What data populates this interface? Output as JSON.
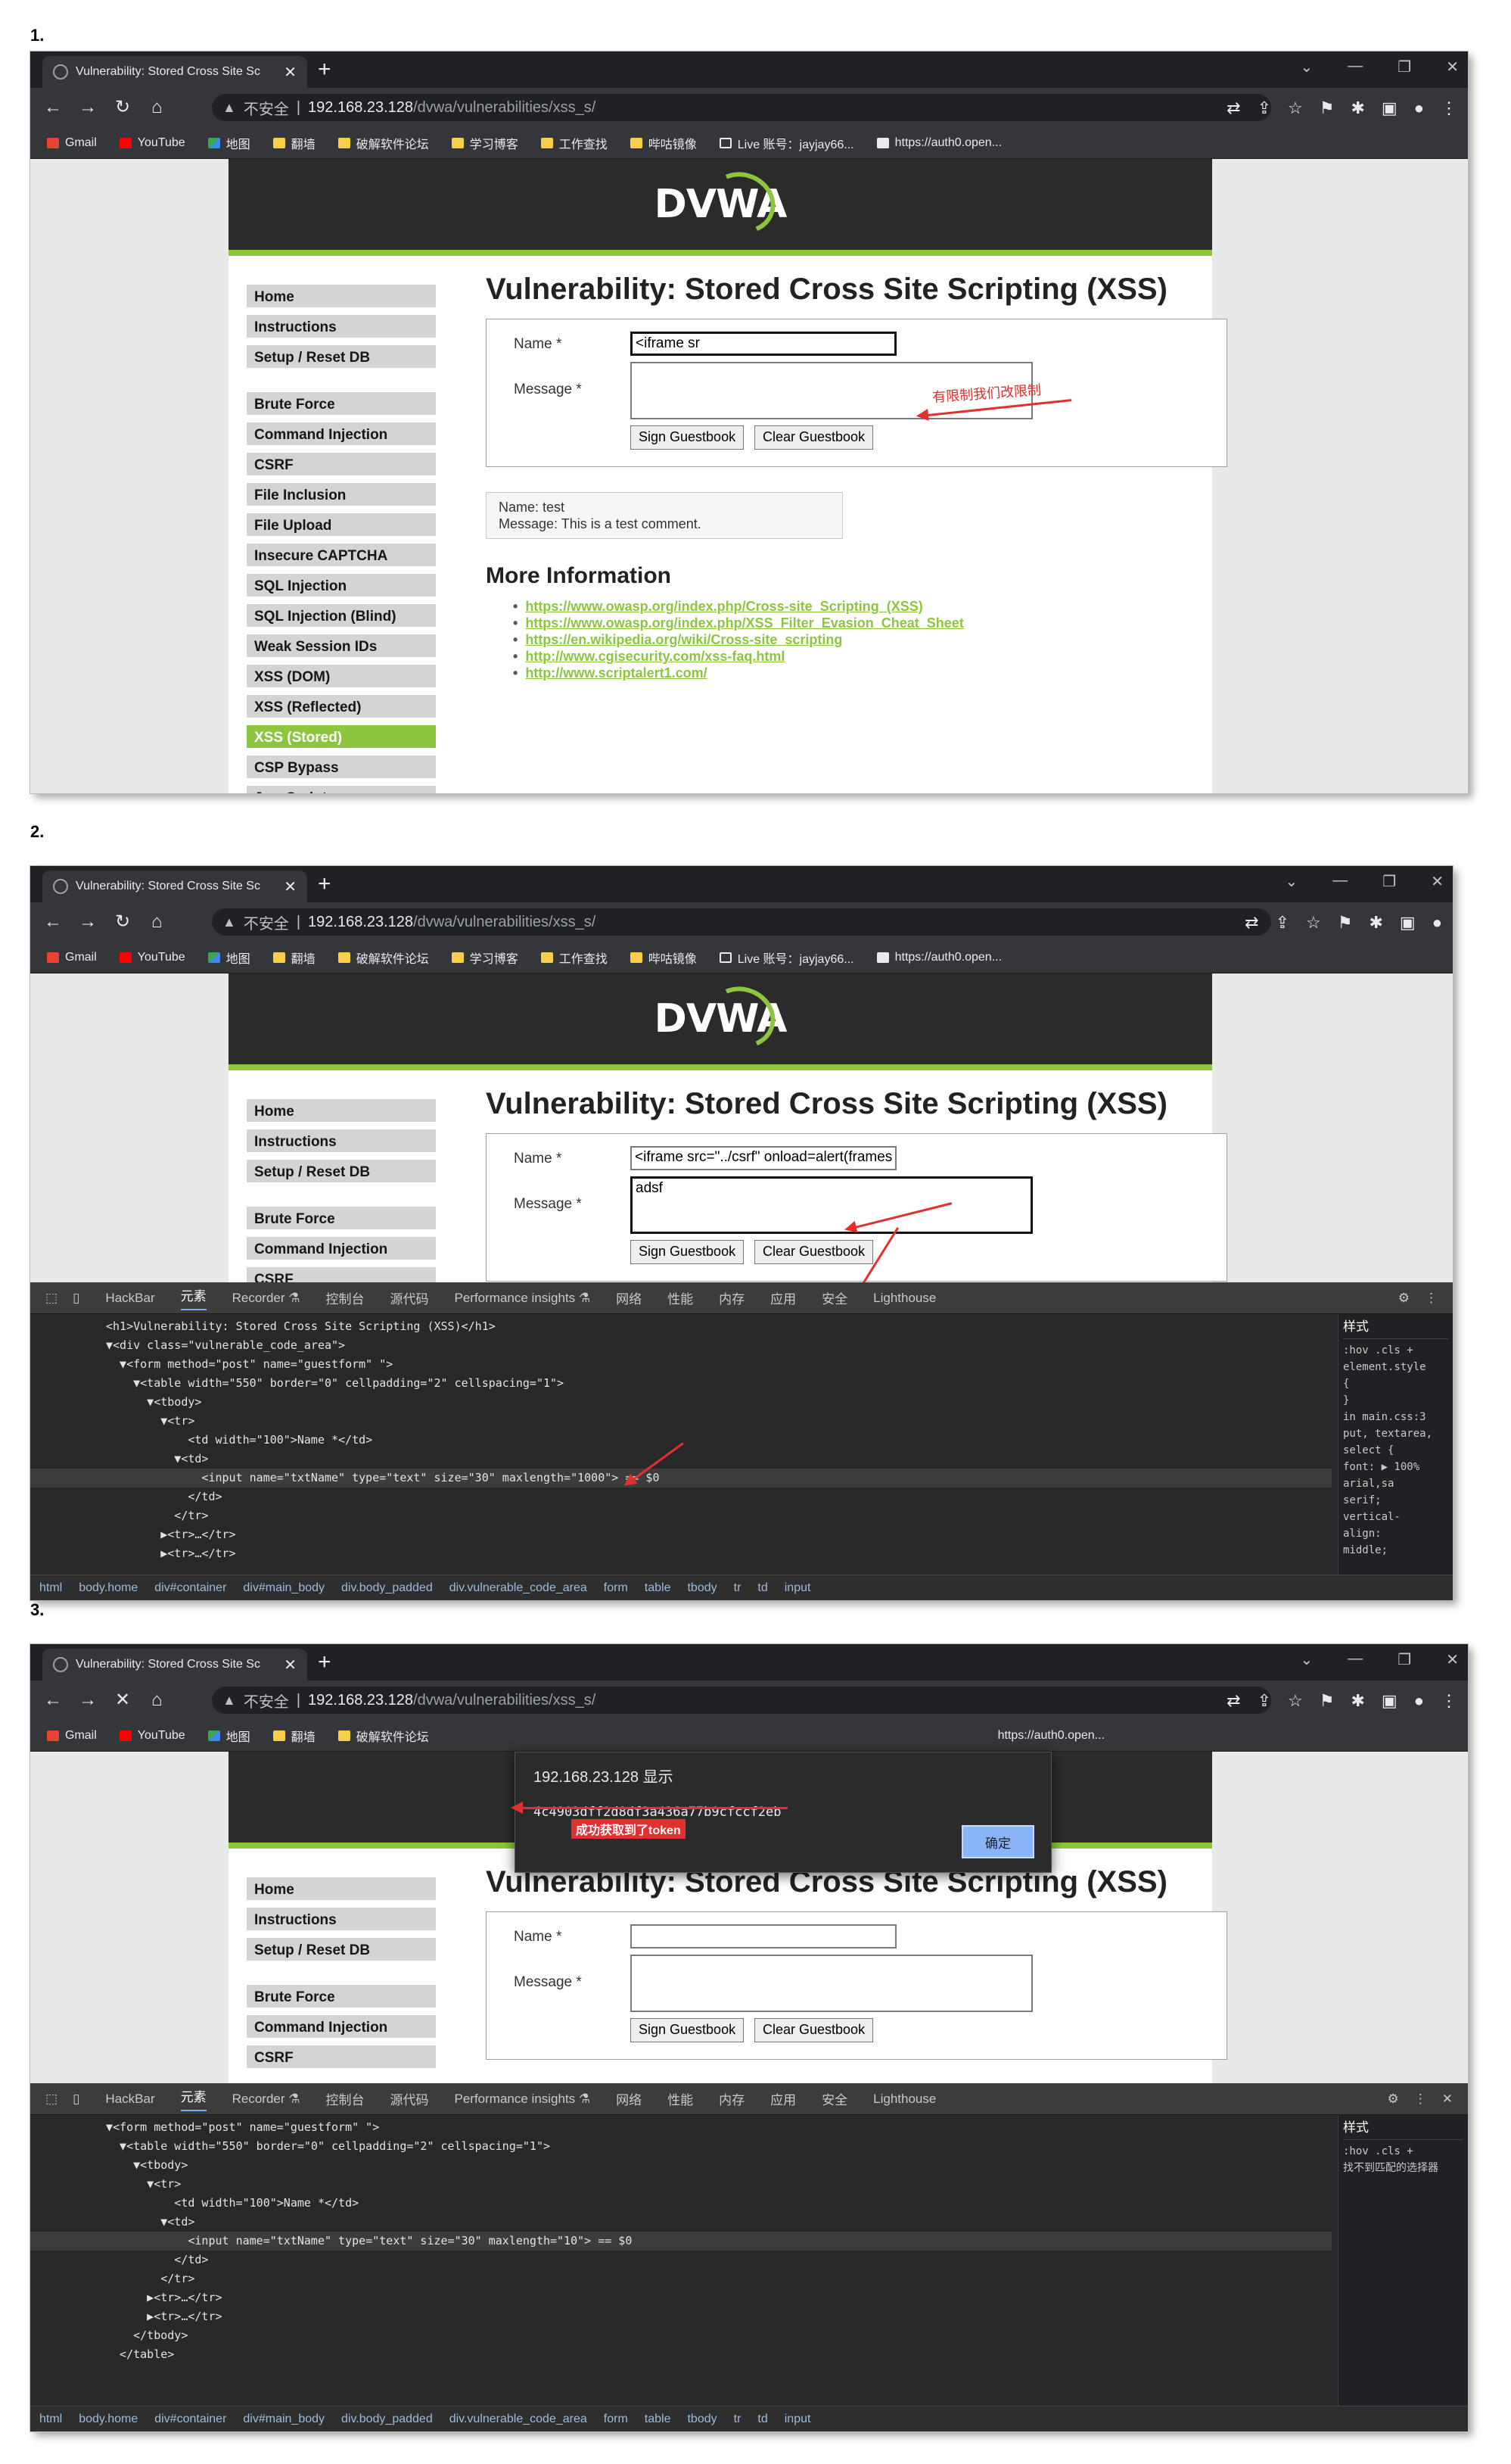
{
  "steps": [
    "1.",
    "2.",
    "3."
  ],
  "browser": {
    "tab_title": "Vulnerability: Stored Cross Site Sc",
    "insecure_label": "不安全",
    "url_host": "192.168.23.128",
    "url_path": "/dvwa/vulnerabilities/xss_s/",
    "bookmarks": [
      "Gmail",
      "YouTube",
      "地图",
      "翻墙",
      "破解软件论坛",
      "学习博客",
      "工作查找",
      "哔咕镜像",
      "Live 账号：jayjay66...",
      "https://auth0.open..."
    ]
  },
  "dvwa": {
    "logo": "DVWA",
    "title": "Vulnerability: Stored Cross Site Scripting (XSS)",
    "name_label": "Name *",
    "message_label": "Message *",
    "sign_button": "Sign Guestbook",
    "clear_button": "Clear Guestbook",
    "guestbook_name": "Name: test",
    "guestbook_message": "Message: This is a test comment.",
    "more_info": "More Information",
    "links": [
      "https://www.owasp.org/index.php/Cross-site_Scripting_(XSS)",
      "https://www.owasp.org/index.php/XSS_Filter_Evasion_Cheat_Sheet",
      "https://en.wikipedia.org/wiki/Cross-site_scripting",
      "http://www.cgisecurity.com/xss-faq.html",
      "http://www.scriptalert1.com/"
    ],
    "menu": [
      "Home",
      "Instructions",
      "Setup / Reset DB",
      "Brute Force",
      "Command Injection",
      "CSRF",
      "File Inclusion",
      "File Upload",
      "Insecure CAPTCHA",
      "SQL Injection",
      "SQL Injection (Blind)",
      "Weak Session IDs",
      "XSS (DOM)",
      "XSS (Reflected)",
      "XSS (Stored)",
      "CSP Bypass",
      "JavaScript"
    ],
    "partial_menu_item": "CSRF"
  },
  "shot1": {
    "name_value": "<iframe sr",
    "annotation": "有限制我们改限制"
  },
  "shot2": {
    "name_value": "<iframe src=\"../csrf\" onload=alert(frames",
    "message_value": "adsf"
  },
  "devtools": {
    "tabs": [
      "HackBar",
      "元素",
      "Recorder ⚗",
      "控制台",
      "源代码",
      "Performance insights ⚗",
      "网络",
      "性能",
      "内存",
      "应用",
      "安全",
      "Lighthouse"
    ],
    "styles_tab": "样式",
    "crumbs": [
      "html",
      "body.home",
      "div#container",
      "div#main_body",
      "div.body_padded",
      "div.vulnerable_code_area",
      "form",
      "table",
      "tbody",
      "tr",
      "td",
      "input"
    ],
    "shot2_lines": [
      "<h1>Vulnerability: Stored Cross Site Scripting (XSS)</h1>",
      "▼<div class=\"vulnerable_code_area\">",
      "  ▼<form method=\"post\" name=\"guestform\" \">",
      "    ▼<table width=\"550\" border=\"0\" cellpadding=\"2\" cellspacing=\"1\">",
      "      ▼<tbody>",
      "        ▼<tr>",
      "            <td width=\"100\">Name *</td>",
      "          ▼<td>",
      "              <input name=\"txtName\" type=\"text\" size=\"30\" maxlength=\"1000\"> == $0",
      "            </td>",
      "          </tr>",
      "        ▶<tr>…</tr>",
      "        ▶<tr>…</tr>"
    ],
    "shot3_lines": [
      "▼<form method=\"post\" name=\"guestform\" \">",
      "  ▼<table width=\"550\" border=\"0\" cellpadding=\"2\" cellspacing=\"1\">",
      "    ▼<tbody>",
      "      ▼<tr>",
      "          <td width=\"100\">Name *</td>",
      "        ▼<td>",
      "            <input name=\"txtName\" type=\"text\" size=\"30\" maxlength=\"10\"> == $0",
      "          </td>",
      "        </tr>",
      "      ▶<tr>…</tr>",
      "      ▶<tr>…</tr>",
      "    </tbody>",
      "  </table>"
    ],
    "styles_shot2": [
      ":hov  .cls  +",
      "element.style",
      "{",
      "}",
      "in  main.css:3",
      "put, textarea,",
      "select {",
      "  font: ▶ 100%",
      "    arial,sa",
      "    serif;",
      "  vertical-",
      "    align:",
      "    middle;"
    ],
    "styles_shot3": [
      ":hov  .cls  +",
      "找不到匹配的选择器"
    ]
  },
  "alert": {
    "title": "192.168.23.128 显示",
    "message": "4c4903dff2d8df3a436a77b9cfccf2eb",
    "ok": "确定",
    "annotation": "成功获取到了token"
  }
}
